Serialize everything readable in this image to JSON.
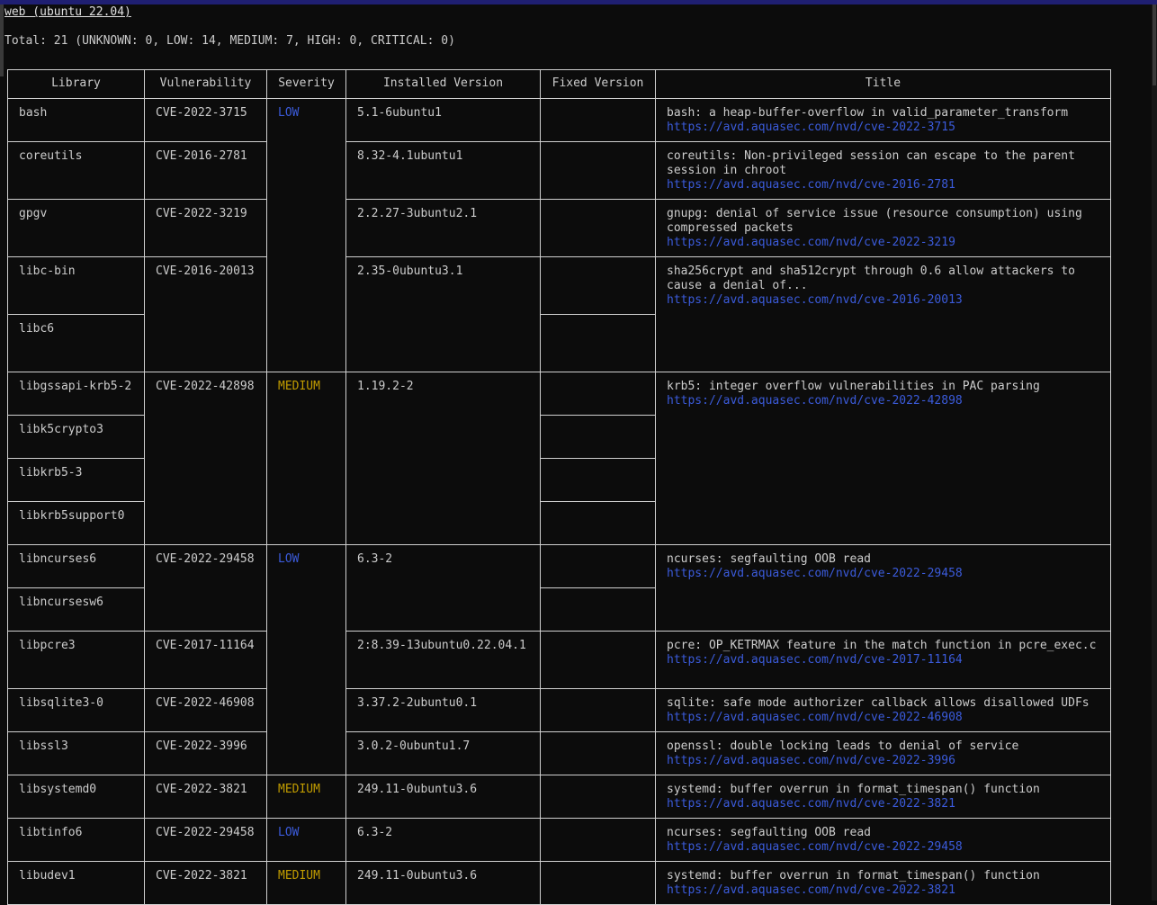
{
  "header": {
    "target": "web (ubuntu 22.04)",
    "total": "Total: 21 (UNKNOWN: 0, LOW: 14, MEDIUM: 7, HIGH: 0, CRITICAL: 0)"
  },
  "columns": [
    "Library",
    "Vulnerability",
    "Severity",
    "Installed Version",
    "Fixed Version",
    "Title"
  ],
  "colors": {
    "low": "#3b5bdb",
    "medium": "#c19c00",
    "link": "#3b5bdb"
  },
  "libraries": [
    "bash",
    "coreutils",
    "gpgv",
    "libc-bin",
    "libc6",
    "libgssapi-krb5-2",
    "libk5crypto3",
    "libkrb5-3",
    "libkrb5support0",
    "libncurses6",
    "libncursesw6",
    "libpcre3",
    "libsqlite3-0",
    "libssl3",
    "libsystemd0",
    "libtinfo6",
    "libudev1"
  ],
  "vulns": [
    {
      "id": "CVE-2022-3715",
      "installed": "5.1-6ubuntu1",
      "title": "bash: a heap-buffer-overflow in valid_parameter_transform",
      "link": "https://avd.aquasec.com/nvd/cve-2022-3715"
    },
    {
      "id": "CVE-2016-2781",
      "installed": "8.32-4.1ubuntu1",
      "title": "coreutils: Non-privileged session can escape to the parent session in chroot",
      "link": "https://avd.aquasec.com/nvd/cve-2016-2781"
    },
    {
      "id": "CVE-2022-3219",
      "installed": "2.2.27-3ubuntu2.1",
      "title": "gnupg: denial of service issue (resource consumption) using compressed packets",
      "link": "https://avd.aquasec.com/nvd/cve-2022-3219"
    },
    {
      "id": "CVE-2016-20013",
      "installed": "2.35-0ubuntu3.1",
      "title": "sha256crypt and sha512crypt through 0.6 allow attackers to cause a denial of...",
      "link": "https://avd.aquasec.com/nvd/cve-2016-20013"
    },
    {
      "id": "CVE-2022-42898",
      "installed": "1.19.2-2",
      "title": "krb5: integer overflow vulnerabilities in PAC parsing",
      "link": "https://avd.aquasec.com/nvd/cve-2022-42898"
    },
    {
      "id": "CVE-2022-29458",
      "installed": "6.3-2",
      "title": "ncurses: segfaulting OOB read",
      "link": "https://avd.aquasec.com/nvd/cve-2022-29458"
    },
    {
      "id": "CVE-2017-11164",
      "installed": "2:8.39-13ubuntu0.22.04.1",
      "title": "pcre: OP_KETRMAX feature in the match function in pcre_exec.c",
      "link": "https://avd.aquasec.com/nvd/cve-2017-11164"
    },
    {
      "id": "CVE-2022-46908",
      "installed": "3.37.2-2ubuntu0.1",
      "title": "sqlite: safe mode authorizer callback allows disallowed UDFs",
      "link": "https://avd.aquasec.com/nvd/cve-2022-46908"
    },
    {
      "id": "CVE-2022-3996",
      "installed": "3.0.2-0ubuntu1.7",
      "title": "openssl: double locking leads to denial of service",
      "link": "https://avd.aquasec.com/nvd/cve-2022-3996"
    },
    {
      "id": "CVE-2022-3821",
      "installed": "249.11-0ubuntu3.6",
      "title": "systemd: buffer overrun in format_timespan() function",
      "link": "https://avd.aquasec.com/nvd/cve-2022-3821"
    },
    {
      "id": "CVE-2022-29458",
      "installed": "6.3-2",
      "title": "ncurses: segfaulting OOB read",
      "link": "https://avd.aquasec.com/nvd/cve-2022-29458"
    },
    {
      "id": "CVE-2022-3821",
      "installed": "249.11-0ubuntu3.6",
      "title": "systemd: buffer overrun in format_timespan() function",
      "link": "https://avd.aquasec.com/nvd/cve-2022-3821"
    }
  ],
  "severity": {
    "low": "LOW",
    "medium": "MEDIUM"
  }
}
